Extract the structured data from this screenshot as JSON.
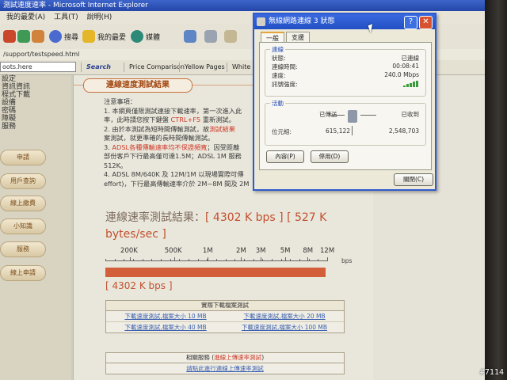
{
  "browser": {
    "title": "測試速度速率 - Microsoft Internet Explorer",
    "menu": [
      "我的最愛(A)",
      "工具(T)",
      "說明(H)"
    ],
    "toolbar": {
      "search": "搜尋",
      "favorites": "我的最愛",
      "media": "媒體"
    },
    "address": "/support/testspeed.html",
    "search_combo": "oots.here",
    "links": [
      "Search",
      "Price Comparison",
      "Yellow Pages",
      "White P"
    ]
  },
  "leftnav": {
    "items": [
      "設定",
      "資訊資訊",
      "程式下載",
      "設備",
      "密碼",
      "障礙",
      "服務"
    ],
    "buttons": [
      "申請",
      "用戶查詢",
      "線上繳費",
      "小知識",
      "服務",
      "線上申請"
    ]
  },
  "content": {
    "section_title": "連線速度測試結果",
    "notes": [
      {
        "text": "注意事項：",
        "hl": ""
      },
      {
        "text": "1. 本網頁僅限測試連接下載速率，第一次進入此",
        "hl": ""
      },
      {
        "text": "率，此時請您按下鍵盤 ",
        "hl": "CTRL+F5",
        "tail": " 重新測試。"
      },
      {
        "text": "2. 由於本測試為短時間傳輸測試，故",
        "hl": "測試結果",
        "tail": ""
      },
      {
        "text": "案測試，就更準確的長時間傳輸測試。",
        "hl": ""
      },
      {
        "text": "3. ",
        "hl": "ADSL各種傳輸速率均不保證頻寬",
        "tail": "；因受距離"
      },
      {
        "text": "部份客戶下行最高僅可達1.5M；ADSL 1M 服務",
        "hl": ""
      },
      {
        "text": "512K。",
        "hl": ""
      },
      {
        "text": "4. ADSL 8M/640K 及 12M/1M 以現場實際可傳",
        "hl": ""
      },
      {
        "text": "effort)，下行最高傳輸速率介於 2M~8M 間及 2M",
        "hl": ""
      }
    ],
    "result_prefix": "連線速率測試結果：",
    "result_kbps": "[ 4302 K bps ]",
    "result_bytes": "[ 527 K bytes/sec ]",
    "scale_labels": [
      "200K",
      "500K",
      "1M",
      "2M",
      "3M",
      "5M",
      "8M",
      "12M"
    ],
    "scale_unit": "bps",
    "bar_label": "[ 4302 K bps ]",
    "speed_kbps": 4302,
    "download_table": {
      "header": "實際下載檔案測試",
      "rows": [
        [
          "下載速度測試,檔案大小 10 MB",
          "下載速度測試,檔案大小 20 MB"
        ],
        [
          "下載速度測試,檔案大小 40 MB",
          "下載速度測試,檔案大小 100 MB"
        ]
      ]
    },
    "related": {
      "header_prefix": "相關服務 (",
      "header_hl": "進線上傳速率測試",
      "header_suffix": ")",
      "link": "請點此進行連線上傳速率測試"
    }
  },
  "dialog": {
    "title": "無線網路連線 3 狀態",
    "tabs": [
      "一般",
      "支援"
    ],
    "connection_group": "連線",
    "rows": [
      {
        "label": "狀態:",
        "value": "已連線"
      },
      {
        "label": "連線時間:",
        "value": "00:08:41"
      },
      {
        "label": "速度:",
        "value": "240.0 Mbps"
      },
      {
        "label": "訊號強度:",
        "value": ""
      }
    ],
    "activity_group": "活動",
    "sent_label": "已傳送",
    "recv_label": "已收到",
    "bytes_label": "位元組:",
    "sent_bytes": "615,122",
    "recv_bytes": "2,548,703",
    "btn_properties": "內容(P)",
    "btn_disable": "停用(D)",
    "btn_close": "關閉(C)"
  },
  "watermark": "#7114",
  "colors": {
    "accent": "#c2502f",
    "bar": "#d35f3a",
    "link": "#3a5fb0",
    "dialog_title": "#2150c4"
  }
}
